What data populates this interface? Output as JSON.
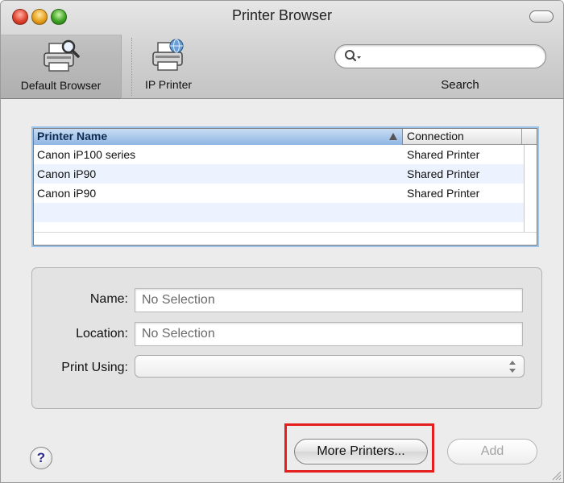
{
  "window": {
    "title": "Printer Browser"
  },
  "toolbar": {
    "default_browser_label": "Default Browser",
    "ip_printer_label": "IP Printer",
    "search_label": "Search",
    "search_value": ""
  },
  "printer_list": {
    "columns": [
      "Printer Name",
      "Connection"
    ],
    "sort_column": "Printer Name",
    "rows": [
      {
        "name": "Canon iP100 series",
        "connection": "Shared Printer"
      },
      {
        "name": "Canon iP90",
        "connection": "Shared Printer"
      },
      {
        "name": "Canon iP90",
        "connection": "Shared Printer"
      }
    ]
  },
  "details": {
    "name_label": "Name:",
    "name_value": "No Selection",
    "location_label": "Location:",
    "location_value": "No Selection",
    "print_using_label": "Print Using:",
    "print_using_value": ""
  },
  "buttons": {
    "help": "?",
    "more_printers": "More Printers...",
    "add": "Add"
  },
  "colors": {
    "header_selected": "#8fb6e3",
    "row_alternate": "#edf3fe",
    "highlight_box": "#e41d1d"
  },
  "icons": {
    "window_controls": [
      "close-button",
      "minimize-button",
      "zoom-button"
    ],
    "toolbar": [
      "printer-magnifier-icon",
      "printer-globe-icon",
      "search-icon"
    ]
  }
}
